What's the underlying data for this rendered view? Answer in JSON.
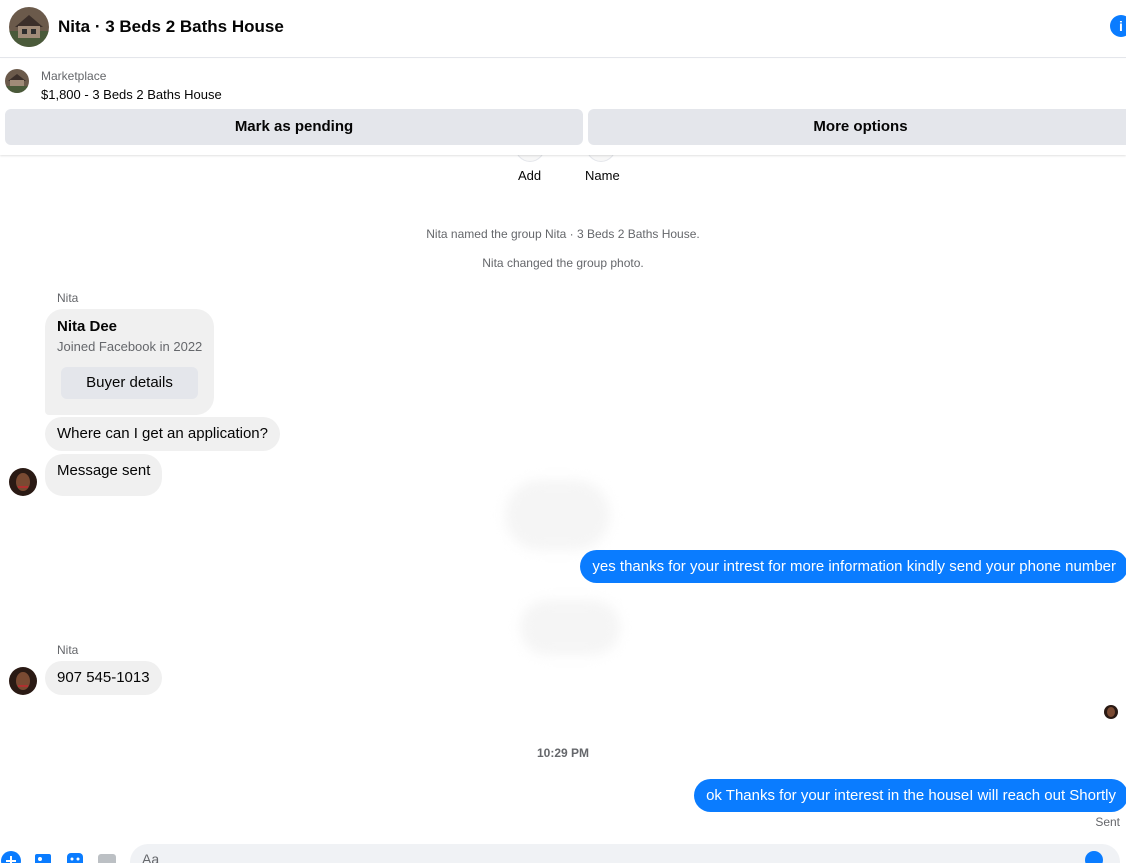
{
  "header": {
    "title": "Nita · 3 Beds 2 Baths House",
    "info_icon": "i"
  },
  "listing": {
    "label": "Marketplace",
    "price_title": "$1,800 - 3 Beds 2 Baths House",
    "mark_pending": "Mark as pending",
    "more_options": "More options"
  },
  "group_actions": {
    "add": "Add",
    "name": "Name"
  },
  "system": {
    "named": "Nita named the group Nita · 3 Beds 2 Baths House.",
    "photo": "Nita changed the group photo."
  },
  "messages": {
    "sender1": "Nita",
    "card_name": "Nita Dee",
    "card_sub": "Joined Facebook in 2022",
    "buyer_details": "Buyer details",
    "q1": "Where can I get an application?",
    "q2": "Message sent",
    "out1": "yes thanks for your intrest for more information kindly send your phone number",
    "sender2": "Nita",
    "phone": "907 545-1013",
    "time": "10:29 PM",
    "out2": "ok Thanks for your interest in the houseI will reach out Shortly",
    "sent": "Sent"
  },
  "composer": {
    "placeholder": "Aa",
    "gif": "GIF"
  },
  "colors": {
    "accent": "#0a7cff",
    "bubble_in": "#f0f0f0",
    "button_gray": "#e4e6eb"
  }
}
